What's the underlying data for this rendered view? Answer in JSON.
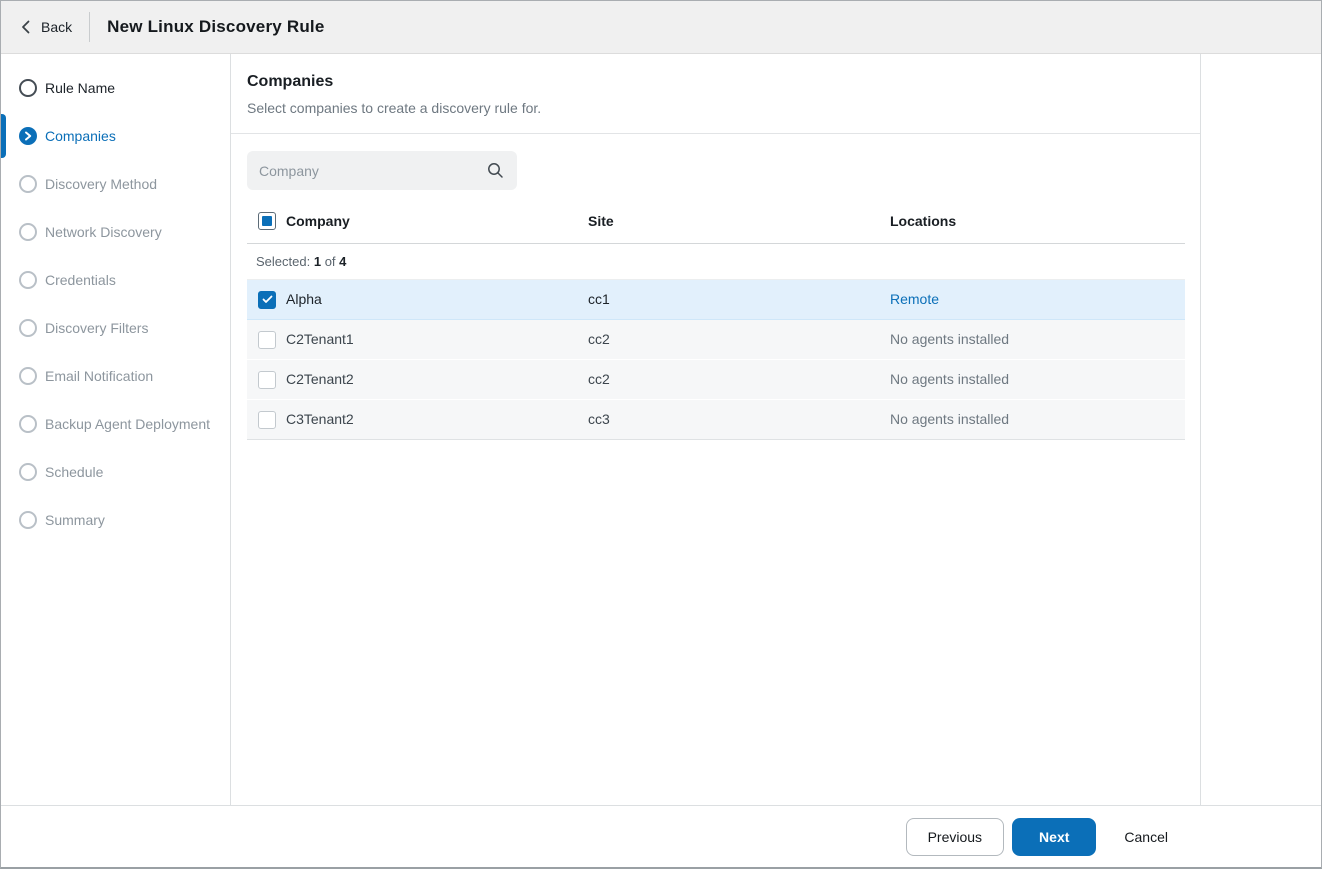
{
  "header": {
    "back_label": "Back",
    "title": "New Linux Discovery Rule"
  },
  "sidebar": {
    "steps": [
      {
        "label": "Rule Name",
        "state": "done"
      },
      {
        "label": "Companies",
        "state": "active"
      },
      {
        "label": "Discovery Method",
        "state": "upcoming"
      },
      {
        "label": "Network Discovery",
        "state": "upcoming"
      },
      {
        "label": "Credentials",
        "state": "upcoming"
      },
      {
        "label": "Discovery Filters",
        "state": "upcoming"
      },
      {
        "label": "Email Notification",
        "state": "upcoming"
      },
      {
        "label": "Backup Agent Deployment",
        "state": "upcoming"
      },
      {
        "label": "Schedule",
        "state": "upcoming"
      },
      {
        "label": "Summary",
        "state": "upcoming"
      }
    ]
  },
  "main": {
    "section_title": "Companies",
    "section_subtitle": "Select companies to create a discovery rule for.",
    "search": {
      "placeholder": "Company",
      "icon": "magnifier"
    },
    "table": {
      "columns": {
        "company": "Company",
        "site": "Site",
        "locations": "Locations"
      },
      "header_checkbox_state": "indeterminate",
      "selected_summary": {
        "label": "Selected:",
        "count": "1",
        "of_label": "of",
        "total": "4"
      },
      "rows": [
        {
          "company": "Alpha",
          "site": "cc1",
          "locations": "Remote",
          "checked": true,
          "locations_is_link": true
        },
        {
          "company": "C2Tenant1",
          "site": "cc2",
          "locations": "No agents installed",
          "checked": false,
          "locations_is_link": false
        },
        {
          "company": "C2Tenant2",
          "site": "cc2",
          "locations": "No agents installed",
          "checked": false,
          "locations_is_link": false
        },
        {
          "company": "C3Tenant2",
          "site": "cc3",
          "locations": "No agents installed",
          "checked": false,
          "locations_is_link": false
        }
      ]
    }
  },
  "footer": {
    "previous_label": "Previous",
    "next_label": "Next",
    "cancel_label": "Cancel"
  },
  "icons": {
    "back": "chevron-left",
    "active_step": "chevron-right-in-circle",
    "search": "magnifier",
    "row_checked": "checkmark"
  },
  "colors": {
    "accent_blue": "#0b6fb8",
    "link_blue": "#0b6fb8",
    "selected_row_bg": "#e2f0fc",
    "header_bg": "#f0f0f0",
    "row_bg": "#f6f7f8",
    "muted_text": "#6e7881"
  }
}
